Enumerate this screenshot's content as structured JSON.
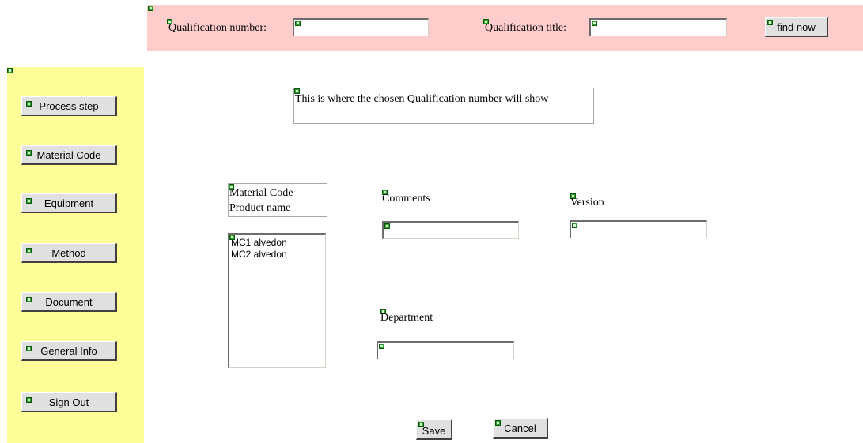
{
  "header": {
    "qualification_number_label": "Qualification number:",
    "qualification_number_value": "",
    "qualification_title_label": "Qualification title:",
    "qualification_title_value": "",
    "find_now_label": "find now"
  },
  "sidebar": {
    "items": [
      {
        "label": "Process step"
      },
      {
        "label": "Material Code"
      },
      {
        "label": "Equipment"
      },
      {
        "label": "Method"
      },
      {
        "label": "Document"
      },
      {
        "label": "General Info"
      },
      {
        "label": "Sign Out"
      }
    ]
  },
  "main": {
    "qualification_display": "This is where the chosen Qualification number will show",
    "material_code_header_line1": "Material Code",
    "material_code_header_line2": "Product name",
    "material_list": [
      "MC1 alvedon",
      "MC2 alvedon"
    ],
    "comments_label": "Comments",
    "comments_value": "",
    "version_label": "Version",
    "version_value": "",
    "department_label": "Department",
    "department_value": "",
    "save_label": "Save",
    "cancel_label": "Cancel"
  },
  "colors": {
    "header_bg": "#ffcccc",
    "sidebar_bg": "#ffff99",
    "button_bg": "#e0e0e0"
  }
}
